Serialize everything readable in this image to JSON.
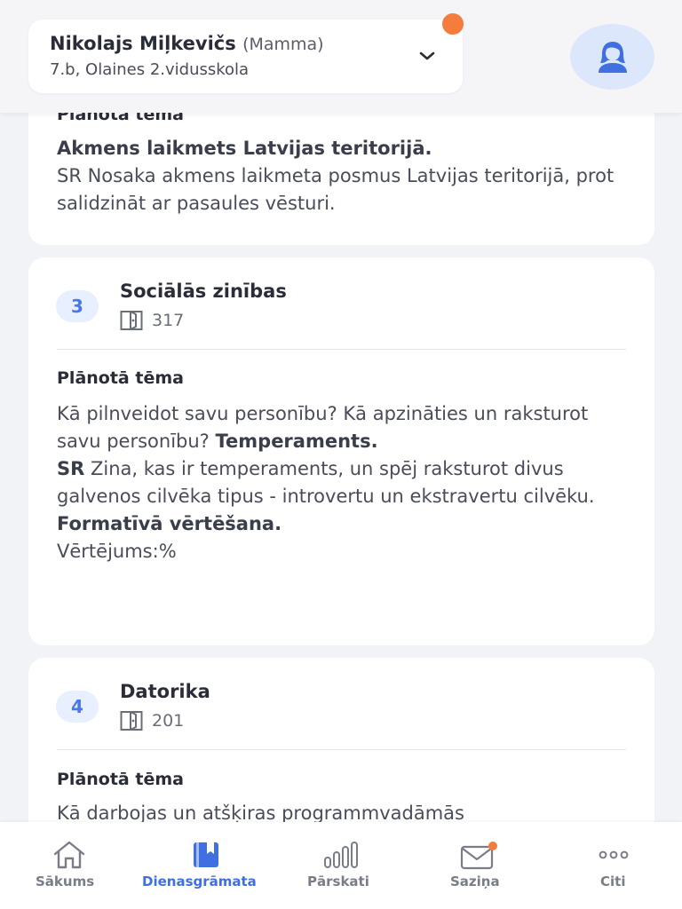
{
  "header": {
    "student_name": "Nikolajs Miļkevičs",
    "role": "(Mamma)",
    "school": "7.b, Olaines 2.vidusskola",
    "notification_color": "#f47c3c"
  },
  "lessons": [
    {
      "section_label": "Plānotā tēma",
      "topic_bold": "Akmens laikmets Latvijas teritorijā.",
      "text": "SR Nosaka akmens laikmeta posmus Latvijas teritorijā, prot salidzināt ar pasaules vēsturi."
    },
    {
      "number": "3",
      "name": "Sociālās zinības",
      "room": "317",
      "section_label": "Plānotā tēma",
      "part1": "Kā pilnveidot savu personību? Kā apzināties un raksturot savu personību? ",
      "bold1": "Temperaments.",
      "bold2": "SR",
      "part2": " Zina, kas ir temperaments, un spēj raksturot divus galvenos cilvēka tipus - introvertu un ekstravertu cilvēku. ",
      "bold3": "Formatīvā vērtēšana.",
      "part3": "Vērtējums:%"
    },
    {
      "number": "4",
      "name": "Datorika",
      "room": "201",
      "section_label": "Plānotā tēma",
      "text": "Kā darbojas un atšķiras programmvadāmās"
    }
  ],
  "nav": {
    "items": [
      {
        "label": "Sākums",
        "icon": "home-icon"
      },
      {
        "label": "Dienasgrāmata",
        "icon": "diary-icon"
      },
      {
        "label": "Pārskati",
        "icon": "bar-chart-icon"
      },
      {
        "label": "Saziņa",
        "icon": "mail-icon"
      },
      {
        "label": "Citi",
        "icon": "more-icon"
      }
    ],
    "active_color": "#3f6fe0"
  }
}
